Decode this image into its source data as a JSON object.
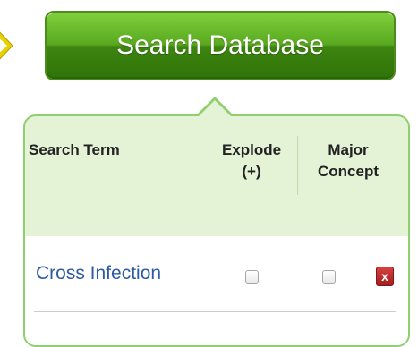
{
  "search_button": {
    "label": "Search Database"
  },
  "table": {
    "columns": [
      {
        "label": "Search Term"
      },
      {
        "label": "Explode (+)"
      },
      {
        "label": "Major Concept"
      }
    ],
    "rows": [
      {
        "term": "Cross Infection",
        "explode": false,
        "major": false,
        "delete_label": "x"
      }
    ]
  },
  "colors": {
    "button_green": "#3d8410",
    "panel_border": "#8fcf6d",
    "panel_fill": "#e4f3d6",
    "link_blue": "#2d5aa6",
    "delete_red": "#a51d1d"
  }
}
